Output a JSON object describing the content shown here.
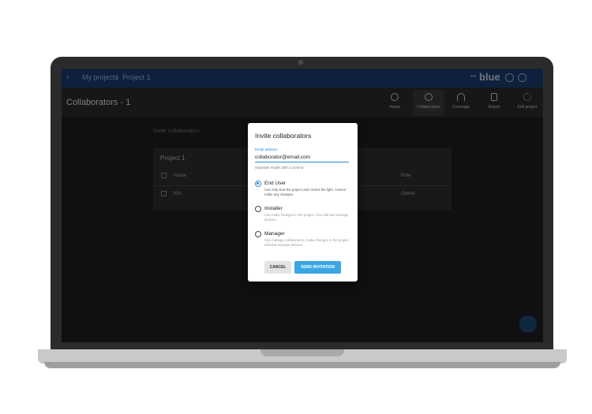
{
  "topbar": {
    "crumb_projects": "My projects",
    "crumb_separator": "/",
    "crumb_project": "Project 1",
    "logo": "blue"
  },
  "subbar": {
    "title": "Collaborators - 1",
    "tools": [
      {
        "label": "Areas",
        "icon": "layers-icon"
      },
      {
        "label": "Collaborators",
        "icon": "people-icon",
        "active": true
      },
      {
        "label": "Coverage",
        "icon": "wifi-icon"
      },
      {
        "label": "Report",
        "icon": "document-icon"
      },
      {
        "label": "Edit project",
        "icon": "gear-icon"
      }
    ]
  },
  "content": {
    "section_label": "Invite collaborators",
    "card_title": "Project 1",
    "columns": {
      "name": "Name",
      "role": "Role"
    },
    "row": {
      "name": "KM",
      "role": "Owner"
    }
  },
  "dialog": {
    "title": "Invite collaborators",
    "email_label": "Email address",
    "email_value": "collaborator@email.com",
    "email_help": "Separate emails with a comma",
    "roles": [
      {
        "name": "End User",
        "description": "Can only view the project and control the light. Cannot make any changes.",
        "checked": true
      },
      {
        "name": "Installer",
        "description": "Can make changes in the project. Can edit and manage devices.",
        "checked": false
      },
      {
        "name": "Manager",
        "description": "Can manage collaborators, make changes in the project, edit and manage devices.",
        "checked": false
      }
    ],
    "cancel_label": "CANCEL",
    "send_label": "SEND INVITATION"
  },
  "colors": {
    "accent": "#3aa7e3",
    "topbar": "#1d3b70"
  }
}
